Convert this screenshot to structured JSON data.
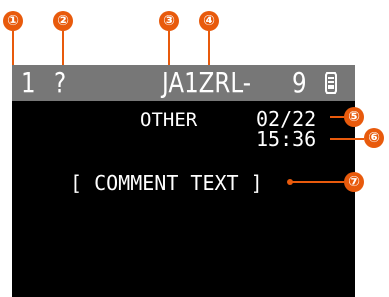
{
  "callouts": [
    "①",
    "②",
    "③",
    "④",
    "⑤",
    "⑥",
    "⑦"
  ],
  "display": {
    "header": {
      "channel": "1",
      "status": "?",
      "callsign": "JA1ZRL-",
      "ssid": "9",
      "symbol_icon": "station-symbol-icon"
    },
    "type_label": "OTHER",
    "date": "02/22",
    "time": "15:36",
    "comment": "[ COMMENT TEXT ]"
  },
  "colors": {
    "accent": "#e85a0c",
    "header_bg": "#777777",
    "screen_bg": "#000000",
    "text": "#ffffff"
  }
}
